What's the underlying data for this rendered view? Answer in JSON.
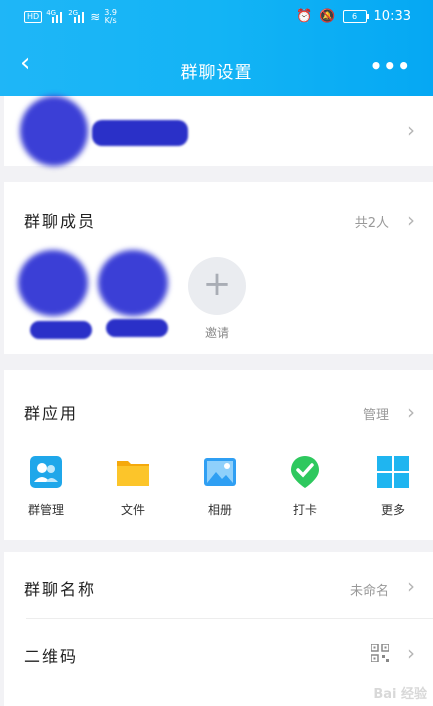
{
  "status_bar": {
    "hd": "HD",
    "signal1": "4G",
    "signal2": "2G",
    "speed_value": "3.9",
    "speed_unit": "K/s",
    "battery": "6",
    "time": "10:33"
  },
  "navbar": {
    "back_icon": "chevron-left-icon",
    "title": "群聊设置",
    "more_icon": "more-dots-icon"
  },
  "members": {
    "title": "群聊成员",
    "count": "共2人",
    "invite_label": "邀请"
  },
  "apps": {
    "title": "群应用",
    "manage": "管理",
    "items": [
      {
        "label": "群管理",
        "icon": "group-manage-icon",
        "color": "#1fa7ea"
      },
      {
        "label": "文件",
        "icon": "folder-icon",
        "color": "#fbbf1a"
      },
      {
        "label": "相册",
        "icon": "album-icon",
        "color": "#2f9ff3"
      },
      {
        "label": "打卡",
        "icon": "checkin-icon",
        "color": "#2ec85e"
      },
      {
        "label": "更多",
        "icon": "grid-more-icon",
        "color": "#1fb5f0"
      }
    ]
  },
  "group_name": {
    "label": "群聊名称",
    "value": "未命名"
  },
  "qrcode": {
    "label": "二维码",
    "icon": "qrcode-icon"
  },
  "watermark": "Bai 经验"
}
